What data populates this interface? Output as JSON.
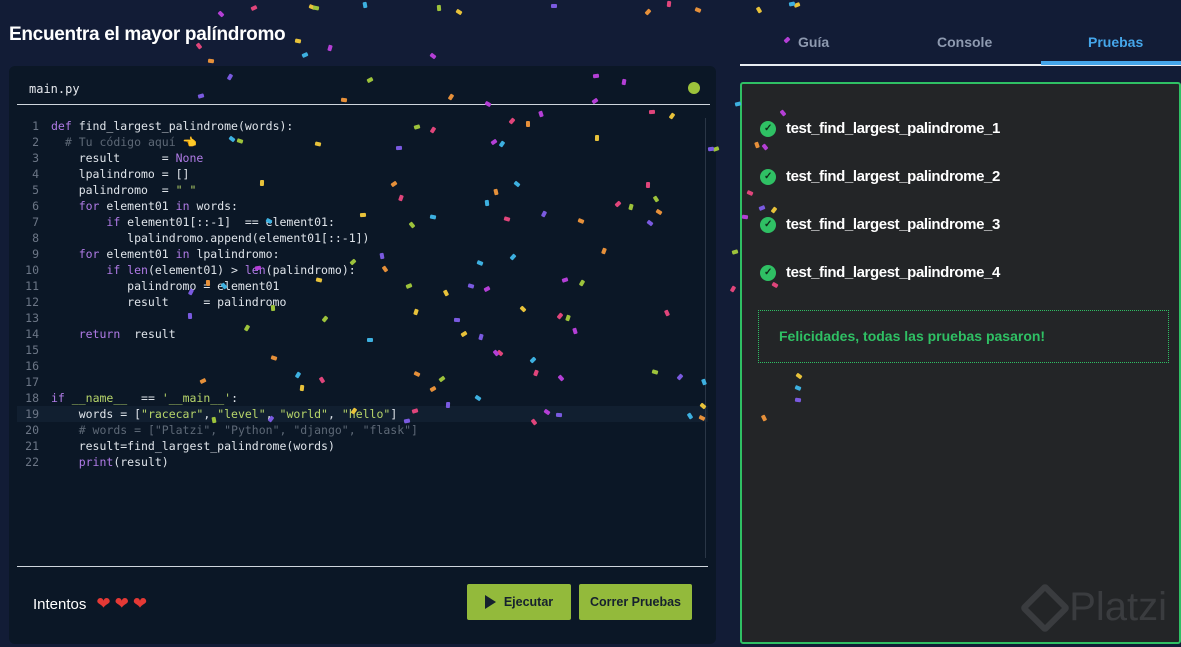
{
  "page": {
    "title": "Encuentra el mayor palíndromo"
  },
  "editor": {
    "filename": "main.py",
    "active_line": 19,
    "lines": [
      [
        [
          "kw",
          "def "
        ],
        [
          "tx",
          "find_largest_palindrome(words):"
        ]
      ],
      [
        [
          "tx",
          "  "
        ],
        [
          "cm",
          "# Tu código aquí 👈"
        ]
      ],
      [
        [
          "tx",
          "    result      = "
        ],
        [
          "kw",
          "None"
        ]
      ],
      [
        [
          "tx",
          "    lpalindromo = []"
        ]
      ],
      [
        [
          "tx",
          "    palindromo  = "
        ],
        [
          "st",
          "\" \""
        ]
      ],
      [
        [
          "tx",
          "    "
        ],
        [
          "kw",
          "for"
        ],
        [
          "tx",
          " element01 "
        ],
        [
          "kw",
          "in"
        ],
        [
          "tx",
          " words:"
        ]
      ],
      [
        [
          "tx",
          "        "
        ],
        [
          "kw",
          "if"
        ],
        [
          "tx",
          " element01[::-1]  == element01:"
        ]
      ],
      [
        [
          "tx",
          "           lpalindromo.append(element01[::-1])"
        ]
      ],
      [
        [
          "tx",
          "    "
        ],
        [
          "kw",
          "for"
        ],
        [
          "tx",
          " element01 "
        ],
        [
          "kw",
          "in"
        ],
        [
          "tx",
          " lpalindromo:"
        ]
      ],
      [
        [
          "tx",
          "        "
        ],
        [
          "kw",
          "if len"
        ],
        [
          "tx",
          "(element01) > "
        ],
        [
          "kw",
          "len"
        ],
        [
          "tx",
          "(palindromo):"
        ]
      ],
      [
        [
          "tx",
          "           palindromo = element01"
        ]
      ],
      [
        [
          "tx",
          "           result     = palindromo"
        ]
      ],
      [],
      [
        [
          "tx",
          "    "
        ],
        [
          "kw",
          "return"
        ],
        [
          "tx",
          "  result"
        ]
      ],
      [],
      [],
      [],
      [
        [
          "kw",
          "if"
        ],
        [
          "tx",
          " "
        ],
        [
          "st",
          "__name__"
        ],
        [
          "tx",
          "  == "
        ],
        [
          "st",
          "'__main__'"
        ],
        [
          "tx",
          ":"
        ]
      ],
      [
        [
          "tx",
          "    words = ["
        ],
        [
          "st",
          "\"racecar\""
        ],
        [
          "tx",
          ", "
        ],
        [
          "st",
          "\"level\""
        ],
        [
          "tx",
          ", "
        ],
        [
          "st",
          "\"world\""
        ],
        [
          "tx",
          ", "
        ],
        [
          "st",
          "\"hello\""
        ],
        [
          "tx",
          "]"
        ]
      ],
      [
        [
          "tx",
          "    "
        ],
        [
          "cm",
          "# words = [\"Platzi\", \"Python\", \"django\", \"flask\"]"
        ]
      ],
      [
        [
          "tx",
          "    result=find_largest_palindrome(words)"
        ]
      ],
      [
        [
          "tx",
          "    "
        ],
        [
          "kw",
          "print"
        ],
        [
          "tx",
          "(result)"
        ]
      ]
    ]
  },
  "footer": {
    "attempts_label": "Intentos",
    "hearts": [
      "❤",
      "❤",
      "❤"
    ],
    "run_label": "Ejecutar",
    "tests_label": "Correr Pruebas"
  },
  "tabs": [
    {
      "label": "Guía"
    },
    {
      "label": "Console"
    },
    {
      "label": "Pruebas"
    }
  ],
  "tests": [
    {
      "name": "test_find_largest_palindrome_1",
      "status": "passed"
    },
    {
      "name": "test_find_largest_palindrome_2",
      "status": "passed"
    },
    {
      "name": "test_find_largest_palindrome_3",
      "status": "passed"
    },
    {
      "name": "test_find_largest_palindrome_4",
      "status": "passed"
    }
  ],
  "result_message": "Felicidades, todas las pruebas pasaron!",
  "logo": "Platzi"
}
